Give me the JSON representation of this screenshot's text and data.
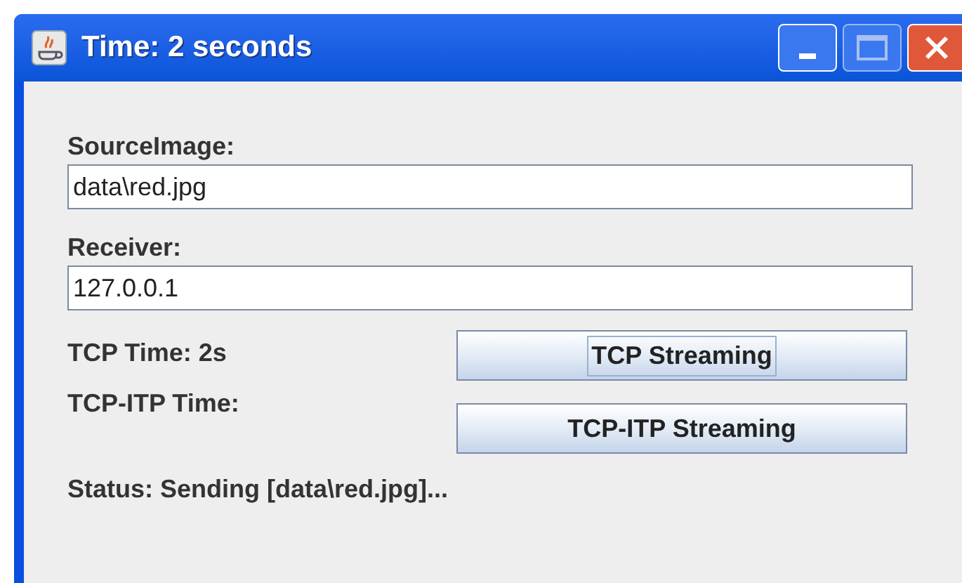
{
  "window": {
    "title": "Time: 2 seconds"
  },
  "fields": [
    {
      "label": "SourceImage:",
      "value": "data\\red.jpg"
    },
    {
      "label": "Receiver:",
      "value": "127.0.0.1"
    }
  ],
  "rows": [
    {
      "label": "TCP Time: 2s",
      "button": {
        "label": "TCP Streaming",
        "focused": true
      }
    },
    {
      "label": "TCP-ITP Time:",
      "button": {
        "label": "TCP-ITP Streaming",
        "focused": false
      }
    }
  ],
  "status": "Status: Sending [data\\red.jpg]..."
}
